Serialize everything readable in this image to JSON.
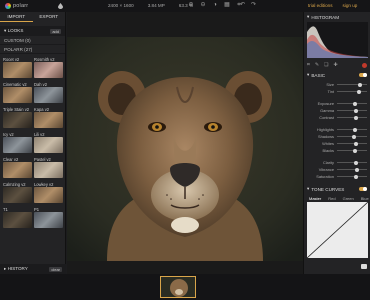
{
  "app": {
    "name": "polarr"
  },
  "image_info": {
    "dimensions": "2400 × 1600",
    "megapixels": "3.84 MP",
    "zoom": "63.3 %"
  },
  "account": {
    "trial": "trial editions",
    "signup": "sign up"
  },
  "left_panel": {
    "tabs": [
      "IMPORT",
      "EXPORT"
    ],
    "looks_header": "LOOKS",
    "add_label": "add",
    "custom": "CUSTOM (0)",
    "polarr": "POLARR (27)",
    "thumbs": [
      {
        "label": "Rocet v2",
        "tone": "warm"
      },
      {
        "label": "Rosmith v2",
        "tone": "pink"
      },
      {
        "label": "Cinematic v2",
        "tone": "warm"
      },
      {
        "label": "Dah v2",
        "tone": "cool"
      },
      {
        "label": "Triple Stain v2",
        "tone": "dim"
      },
      {
        "label": "Kapa v2",
        "tone": "warm"
      },
      {
        "label": "Icy v2",
        "tone": "cool"
      },
      {
        "label": "Lili v2",
        "tone": "soft"
      },
      {
        "label": "Clear v2",
        "tone": "warm"
      },
      {
        "label": "Pastel v2",
        "tone": "soft"
      },
      {
        "label": "Calmzing v2",
        "tone": "dim"
      },
      {
        "label": "Lowkey v2",
        "tone": "warm"
      },
      {
        "label": "T1",
        "tone": "dim"
      },
      {
        "label": "P1",
        "tone": "cool"
      }
    ],
    "history_header": "HISTORY",
    "clear_label": "clear"
  },
  "right_panel": {
    "histogram_header": "HISTOGRAM",
    "basic_header": "BASIC",
    "sliders_a": [
      {
        "name": "Size",
        "value": 0.78
      },
      {
        "name": "Tint",
        "value": 0.74
      }
    ],
    "sliders_b": [
      {
        "name": "Exposure",
        "value": 0.6
      },
      {
        "name": "Gamma",
        "value": 0.62
      },
      {
        "name": "Contrast",
        "value": 0.62
      }
    ],
    "sliders_c": [
      {
        "name": "Highlights",
        "value": 0.6
      },
      {
        "name": "Shadows",
        "value": 0.58
      },
      {
        "name": "Whites",
        "value": 0.62
      },
      {
        "name": "Blacks",
        "value": 0.6
      }
    ],
    "sliders_d": [
      {
        "name": "Clarity",
        "value": 0.64
      },
      {
        "name": "Vibrance",
        "value": 0.66
      },
      {
        "name": "Saturation",
        "value": 0.62
      }
    ],
    "tone_curves_header": "TONE CURVES",
    "curve_tabs": [
      "Master",
      "Red",
      "Green",
      "Blue"
    ]
  },
  "colors": {
    "accent": "#d9a54a",
    "record": "#c0392b"
  }
}
